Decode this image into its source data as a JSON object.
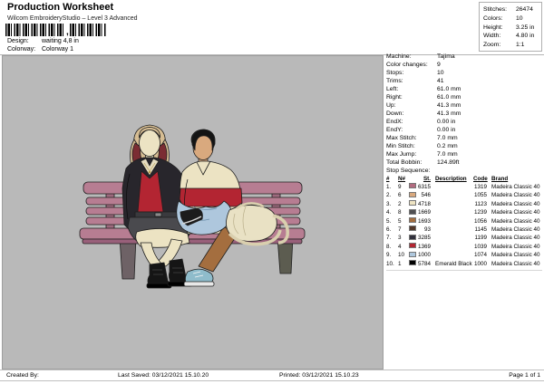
{
  "header": {
    "title": "Production Worksheet",
    "subtitle": "Wilcom EmbroideryStudio – Level 3 Advanced",
    "design_label": "Design:",
    "design_value": "waiting 4,8 in",
    "colorway_label": "Colorway:",
    "colorway_value": "Colorway 1",
    "barcode_comma": ","
  },
  "summary": {
    "rows": [
      {
        "label": "Stitches:",
        "value": "26474"
      },
      {
        "label": "Colors:",
        "value": "10"
      },
      {
        "label": "Height:",
        "value": "3.25 in"
      },
      {
        "label": "Width:",
        "value": "4.80 in"
      },
      {
        "label": "Zoom:",
        "value": "1:1"
      }
    ]
  },
  "machine": {
    "rows": [
      {
        "label": "Machine:",
        "value": "Tajima"
      },
      {
        "label": "Color changes:",
        "value": "9"
      },
      {
        "label": "Stops:",
        "value": "10"
      },
      {
        "label": "Trims:",
        "value": "41"
      },
      {
        "label": "Left:",
        "value": "61.0 mm"
      },
      {
        "label": "Right:",
        "value": "61.0 mm"
      },
      {
        "label": "Up:",
        "value": "41.3 mm"
      },
      {
        "label": "Down:",
        "value": "41.3 mm"
      },
      {
        "label": "EndX:",
        "value": "0.00 in"
      },
      {
        "label": "EndY:",
        "value": "0.00 in"
      },
      {
        "label": "Max Stitch:",
        "value": "7.0 mm"
      },
      {
        "label": "Min Stitch:",
        "value": "0.2 mm"
      },
      {
        "label": "Max Jump:",
        "value": "7.0 mm"
      },
      {
        "label": "Total Bobbin:",
        "value": "124.89ft"
      }
    ]
  },
  "stop": {
    "title": "Stop Sequence:",
    "columns": [
      "#",
      "N#",
      "St.",
      "Description",
      "Code",
      "Brand"
    ],
    "rows": [
      {
        "num": "1.",
        "n": "9",
        "color": "#b26b80",
        "st": "6315",
        "desc": "",
        "code": "1319",
        "brand": "Madeira Classic 40"
      },
      {
        "num": "2.",
        "n": "6",
        "color": "#d9a97e",
        "st": "546",
        "desc": "",
        "code": "1055",
        "brand": "Madeira Classic 40"
      },
      {
        "num": "3.",
        "n": "2",
        "color": "#eee4c3",
        "st": "4718",
        "desc": "",
        "code": "1123",
        "brand": "Madeira Classic 40"
      },
      {
        "num": "4.",
        "n": "8",
        "color": "#4f4f51",
        "st": "1669",
        "desc": "",
        "code": "1239",
        "brand": "Madeira Classic 40"
      },
      {
        "num": "5.",
        "n": "5",
        "color": "#a46e3f",
        "st": "1693",
        "desc": "",
        "code": "1056",
        "brand": "Madeira Classic 40"
      },
      {
        "num": "6.",
        "n": "7",
        "color": "#54392a",
        "st": "93",
        "desc": "",
        "code": "1145",
        "brand": "Madeira Classic 40"
      },
      {
        "num": "7.",
        "n": "3",
        "color": "#30303c",
        "st": "3285",
        "desc": "",
        "code": "1199",
        "brand": "Madeira Classic 40"
      },
      {
        "num": "8.",
        "n": "4",
        "color": "#b32532",
        "st": "1369",
        "desc": "",
        "code": "1039",
        "brand": "Madeira Classic 40"
      },
      {
        "num": "9.",
        "n": "10",
        "color": "#aec7dd",
        "st": "1000",
        "desc": "",
        "code": "1074",
        "brand": "Madeira Classic 40"
      },
      {
        "num": "10.",
        "n": "1",
        "color": "#000000",
        "st": "5784",
        "desc": "Emerald Black",
        "code": "1000",
        "brand": "Madeira Classic 40"
      }
    ]
  },
  "canvas": {
    "background": "#b9b9b9",
    "design_description": "two people waiting on a pink park bench embroidery preview",
    "palette": {
      "bench_pink": "#b77d92",
      "cream": "#ece3c3",
      "tan": "#d9a97e",
      "red": "#b32532",
      "denim_blue": "#aec7dd",
      "brown": "#a46e3f",
      "dark_gray": "#4f4f51",
      "black": "#141414"
    }
  },
  "footer": {
    "created": "Created By:",
    "last_saved": "Last Saved: 03/12/2021 15.10.20",
    "printed": "Printed: 03/12/2021 15.10.23",
    "page": "Page 1 of 1"
  }
}
